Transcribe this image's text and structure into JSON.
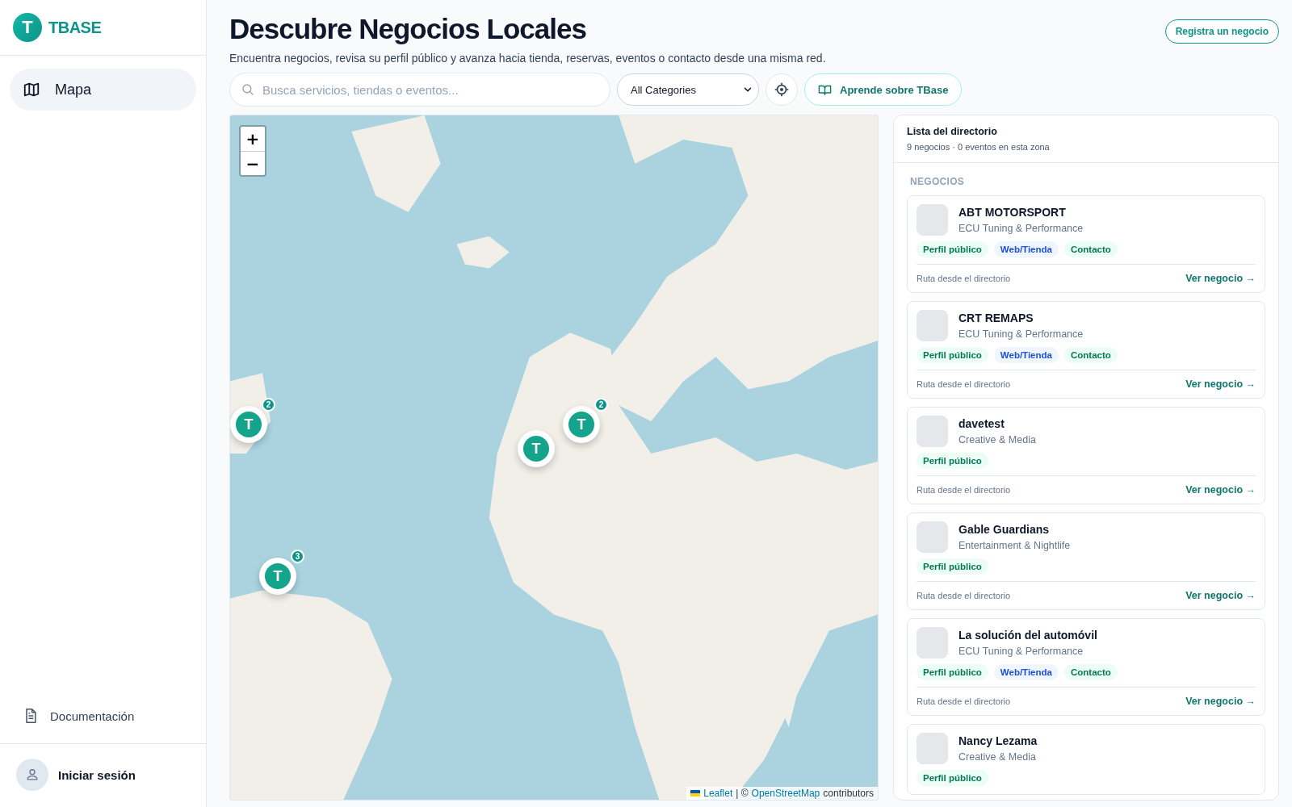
{
  "sidebar": {
    "brand": {
      "logo_letter": "T",
      "name": "TBASE"
    },
    "nav": [
      {
        "label": "Mapa",
        "selected": true
      }
    ],
    "footer_links": [
      {
        "label": "Documentación"
      }
    ],
    "account": {
      "label": "Iniciar sesión"
    }
  },
  "header": {
    "title": "Descubre Negocios Locales",
    "subtitle": "Encuentra negocios, revisa su perfil público y avanza hacia tienda, reservas, eventos o contacto desde una misma red.",
    "register_button": "Registra un negocio"
  },
  "toolbar": {
    "search": {
      "placeholder": "Busca servicios, tiendas o eventos..."
    },
    "category_select": "All Categories",
    "learn_button": "Aprende sobre TBase"
  },
  "map": {
    "zoom_in": "+",
    "zoom_out": "−",
    "markers": [
      {
        "label": "T",
        "count": "2"
      },
      {
        "label": "T",
        "count": "2"
      },
      {
        "label": "T"
      },
      {
        "label": "T",
        "count": "3"
      }
    ],
    "attribution": {
      "link1": "Leaflet",
      "separator": "| ©",
      "link2": "OpenStreetMap",
      "suffix": "contributors"
    }
  },
  "directory": {
    "title": "Lista del directorio",
    "summary": "9 negocios · 0 eventos en esta zona",
    "section": "NEGOCIOS",
    "businesses": [
      {
        "name": "ABT MOTORSPORT",
        "category": "ECU Tuning & Performance",
        "tags": [
          {
            "kind": "public",
            "label": "Perfil público"
          },
          {
            "kind": "web",
            "label": "Web/Tienda"
          },
          {
            "kind": "contact",
            "label": "Contacto"
          }
        ],
        "route": "Ruta desde el directorio",
        "link": "Ver negocio →"
      },
      {
        "name": "CRT REMAPS",
        "category": "ECU Tuning & Performance",
        "tags": [
          {
            "kind": "public",
            "label": "Perfil público"
          },
          {
            "kind": "web",
            "label": "Web/Tienda"
          },
          {
            "kind": "contact",
            "label": "Contacto"
          }
        ],
        "route": "Ruta desde el directorio",
        "link": "Ver negocio →"
      },
      {
        "name": "davetest",
        "category": "Creative & Media",
        "tags": [
          {
            "kind": "public",
            "label": "Perfil público"
          }
        ],
        "route": "Ruta desde el directorio",
        "link": "Ver negocio →"
      },
      {
        "name": "Gable Guardians",
        "category": "Entertainment & Nightlife",
        "tags": [
          {
            "kind": "public",
            "label": "Perfil público"
          }
        ],
        "route": "Ruta desde el directorio",
        "link": "Ver negocio →"
      },
      {
        "name": "La solución del automóvil",
        "category": "ECU Tuning & Performance",
        "tags": [
          {
            "kind": "public",
            "label": "Perfil público"
          },
          {
            "kind": "web",
            "label": "Web/Tienda"
          },
          {
            "kind": "contact",
            "label": "Contacto"
          }
        ],
        "route": "Ruta desde el directorio",
        "link": "Ver negocio →"
      },
      {
        "name": "Nancy Lezama",
        "category": "Creative & Media",
        "tags": [
          {
            "kind": "public",
            "label": "Perfil público"
          }
        ]
      }
    ]
  }
}
